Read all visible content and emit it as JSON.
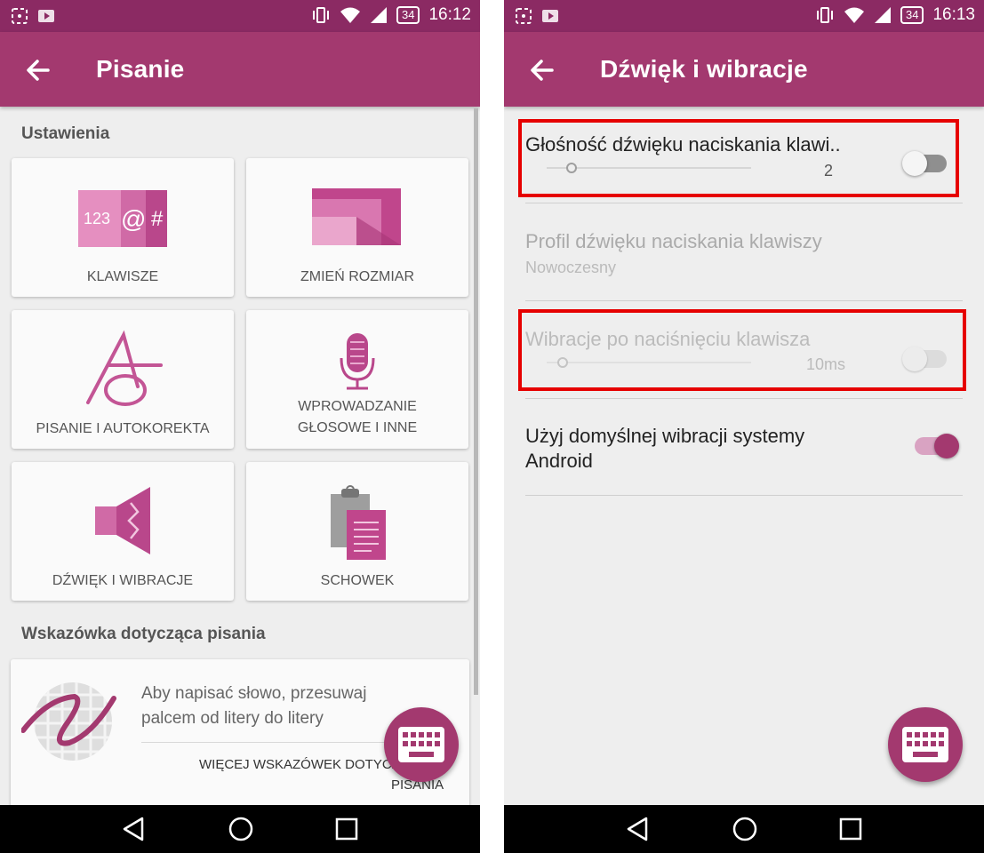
{
  "status_left": {
    "time": "16:12",
    "battery": "34"
  },
  "status_right": {
    "time": "16:13",
    "battery": "34"
  },
  "left_screen": {
    "title": "Pisanie",
    "section_settings": "Ustawienia",
    "tiles": [
      {
        "label": "KLAWISZE",
        "icon": "keys-icon"
      },
      {
        "label": "ZMIEŃ ROZMIAR",
        "icon": "resize-icon"
      },
      {
        "label": "PISANIE I AUTOKOREKTA",
        "icon": "autocorrect-icon"
      },
      {
        "label_line1": "WPROWADZANIE",
        "label_line2": "GŁOSOWE I INNE",
        "icon": "microphone-icon"
      },
      {
        "label": "DŹWIĘK I WIBRACJE",
        "icon": "speaker-icon"
      },
      {
        "label": "SCHOWEK",
        "icon": "clipboard-icon"
      }
    ],
    "section_hint": "Wskazówka dotycząca pisania",
    "hint_line1": "Aby napisać słowo, przesuwaj",
    "hint_line2": "palcem od litery do litery",
    "hint_link_line1": "WIĘCEJ WSKAZÓWEK DOTYCZ",
    "hint_link_line2": "PISANIA"
  },
  "right_screen": {
    "title": "Dźwięk i wibracje",
    "settings": [
      {
        "title": "Głośność dźwięku naciskania klawi..",
        "value": "2",
        "slider": 0.12,
        "toggle_on": false,
        "enabled": true
      },
      {
        "title": "Profil dźwięku naciskania klawiszy",
        "subtitle": "Nowoczesny",
        "enabled": false
      },
      {
        "title": "Wibracje po naciśnięciu klawisza",
        "value": "10ms",
        "slider": 0.08,
        "toggle_on": false,
        "enabled": false
      },
      {
        "title_line1": "Użyj domyślnej wibracji systemy",
        "title_line2": "Android",
        "toggle_on": true,
        "enabled": true
      }
    ]
  },
  "colors": {
    "accent": "#a3396f",
    "statusbar": "#8b2a63",
    "highlight": "#e60000"
  }
}
